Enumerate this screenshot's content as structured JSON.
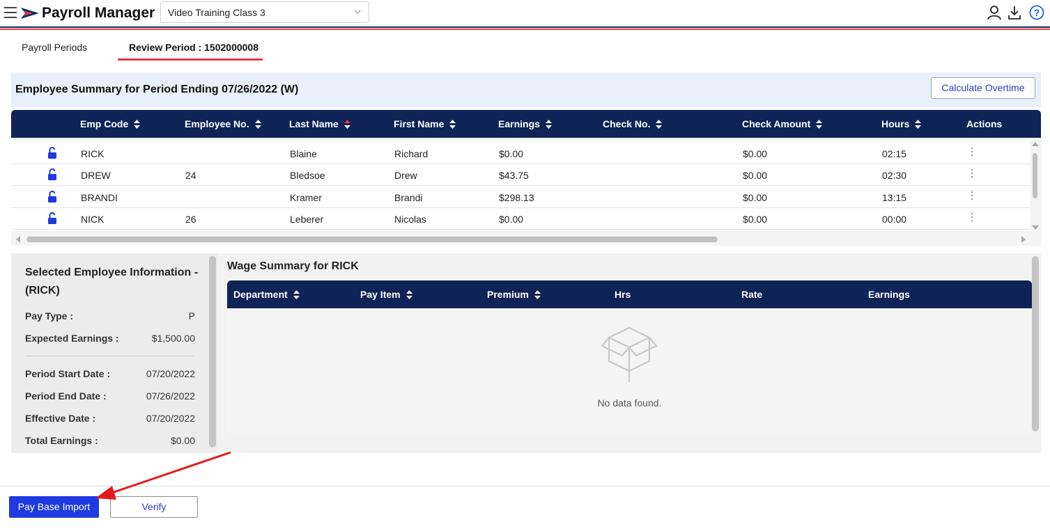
{
  "app": {
    "title": "Payroll Manager",
    "selected_class": "Video Training Class 3",
    "colors": {
      "navy": "#0f2356",
      "accent_red": "#e53946",
      "primary_blue": "#1f3ae0",
      "link_blue": "#2c3db8"
    }
  },
  "header_icons": [
    "user-icon",
    "download-icon",
    "help-icon"
  ],
  "tabs": [
    {
      "label": "Payroll Periods",
      "active": false
    },
    {
      "label": "Review Period : 1502000008",
      "active": true
    }
  ],
  "summary": {
    "title": "Employee Summary for Period Ending 07/26/2022 (W)",
    "calculate_button": "Calculate Overtime"
  },
  "employee_table": {
    "columns": [
      "Emp Code",
      "Employee No.",
      "Last Name",
      "First Name",
      "Earnings",
      "Check No.",
      "Check Amount",
      "Hours",
      "Actions"
    ],
    "sorted_column": "Last Name",
    "rows": [
      {
        "emp_code": "RICK",
        "employee_no": "",
        "last_name": "Blaine",
        "first_name": "Richard",
        "earnings": "$0.00",
        "check_no": "",
        "check_amount": "$0.00",
        "hours": "02:15"
      },
      {
        "emp_code": "DREW",
        "employee_no": "24",
        "last_name": "Bledsoe",
        "first_name": "Drew",
        "earnings": "$43.75",
        "check_no": "",
        "check_amount": "$0.00",
        "hours": "02:30"
      },
      {
        "emp_code": "BRANDI",
        "employee_no": "",
        "last_name": "Kramer",
        "first_name": "Brandi",
        "earnings": "$298.13",
        "check_no": "",
        "check_amount": "$0.00",
        "hours": "13:15"
      },
      {
        "emp_code": "NICK",
        "employee_no": "26",
        "last_name": "Leberer",
        "first_name": "Nicolas",
        "earnings": "$0.00",
        "check_no": "",
        "check_amount": "$0.00",
        "hours": "00:00"
      }
    ]
  },
  "selected_employee": {
    "title": "Selected Employee Information - (RICK)",
    "fields": [
      {
        "label": "Pay Type",
        "value": "P"
      },
      {
        "label": "Expected Earnings",
        "value": "$1,500.00"
      },
      {
        "label": "Period Start Date",
        "value": "07/20/2022"
      },
      {
        "label": "Period End Date",
        "value": "07/26/2022"
      },
      {
        "label": "Effective Date",
        "value": "07/20/2022"
      },
      {
        "label": "Total Earnings",
        "value": "$0.00"
      }
    ]
  },
  "wage_summary": {
    "title": "Wage Summary for RICK",
    "columns": [
      "Department",
      "Pay Item",
      "Premium",
      "Hrs",
      "Rate",
      "Earnings"
    ],
    "empty_message": "No data found."
  },
  "footer": {
    "pay_base_import": "Pay Base Import",
    "verify": "Verify"
  }
}
